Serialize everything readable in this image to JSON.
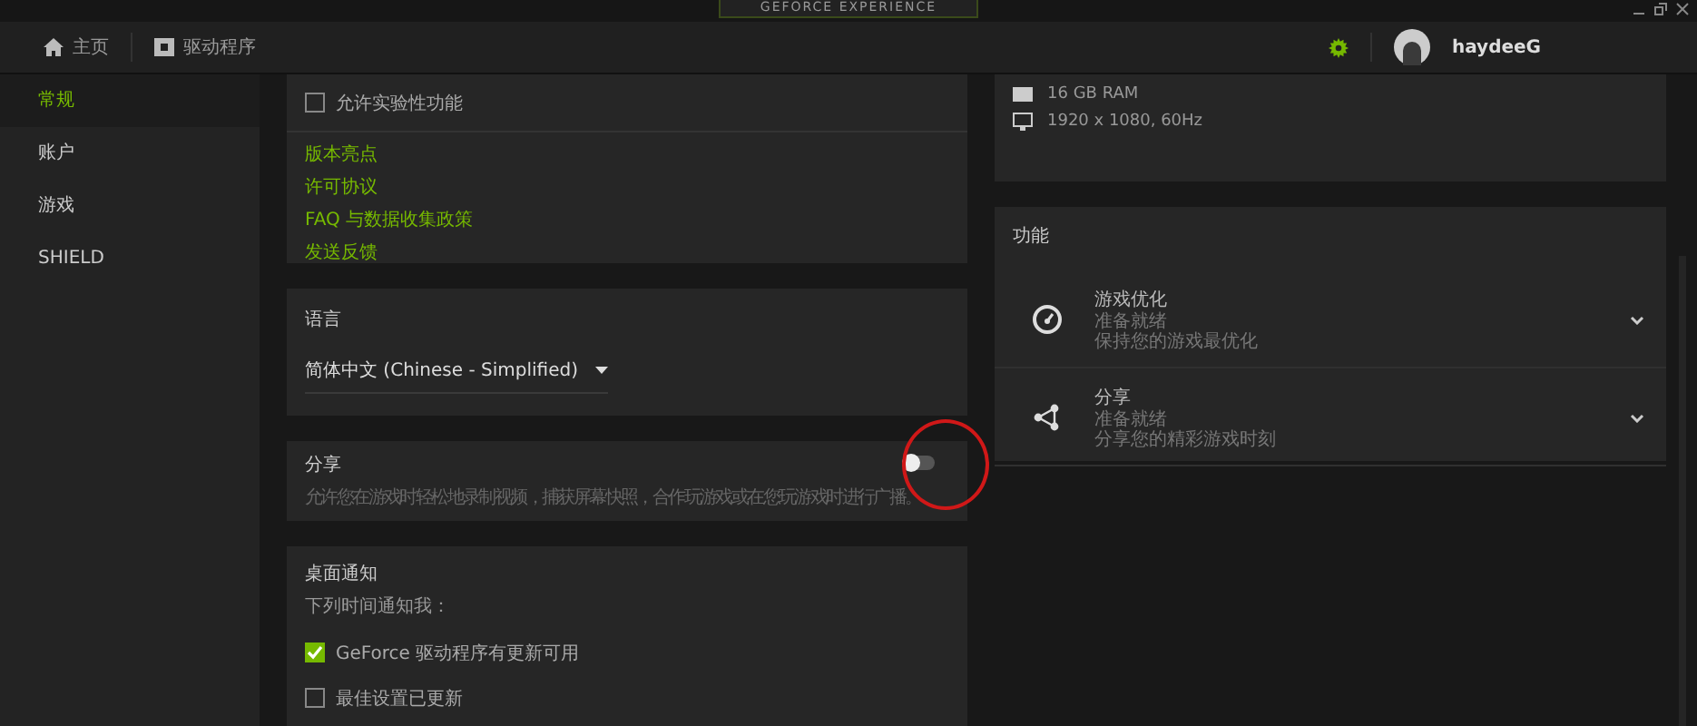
{
  "window": {
    "title": "GEFORCE EXPERIENCE"
  },
  "nav": [
    {
      "label": "主页",
      "kind": "home",
      "selected": false
    },
    {
      "label": "驱动程序",
      "kind": "driver",
      "selected": false
    }
  ],
  "user": {
    "name": "haydeeG"
  },
  "sidebar": {
    "items": [
      {
        "label": "常规",
        "selected": true
      },
      {
        "label": "账户",
        "selected": false
      },
      {
        "label": "游戏",
        "selected": false
      },
      {
        "label": "SHIELD",
        "selected": false
      }
    ]
  },
  "general": {
    "experimental": {
      "label": "允许实验性功能",
      "checked": false
    },
    "links": [
      "版本亮点",
      "许可协议",
      "FAQ 与数据收集政策",
      "发送反馈"
    ]
  },
  "language": {
    "title": "语言",
    "value": "简体中文 (Chinese - Simplified)"
  },
  "share": {
    "title": "分享",
    "description": "允许您在游戏时轻松地录制视频，捕获屏幕快照，合作玩游戏或在您玩游戏时进行广播。",
    "on": false
  },
  "notifications": {
    "title": "桌面通知",
    "subtitle": "下列时间通知我：",
    "options": [
      {
        "label": "GeForce 驱动程序有更新可用",
        "checked": true
      },
      {
        "label": "最佳设置已更新",
        "checked": false
      }
    ]
  },
  "system": [
    {
      "kind": "ram",
      "text": "16 GB RAM"
    },
    {
      "kind": "display",
      "text": "1920 x 1080, 60Hz"
    }
  ],
  "features": {
    "title": "功能",
    "items": [
      {
        "kind": "optimize",
        "name": "游戏优化",
        "status": "准备就绪",
        "description": "保持您的游戏最优化",
        "expanded": false
      },
      {
        "kind": "share",
        "name": "分享",
        "status": "准备就绪",
        "description": "分享您的精彩游戏时刻",
        "expanded": false
      }
    ]
  }
}
